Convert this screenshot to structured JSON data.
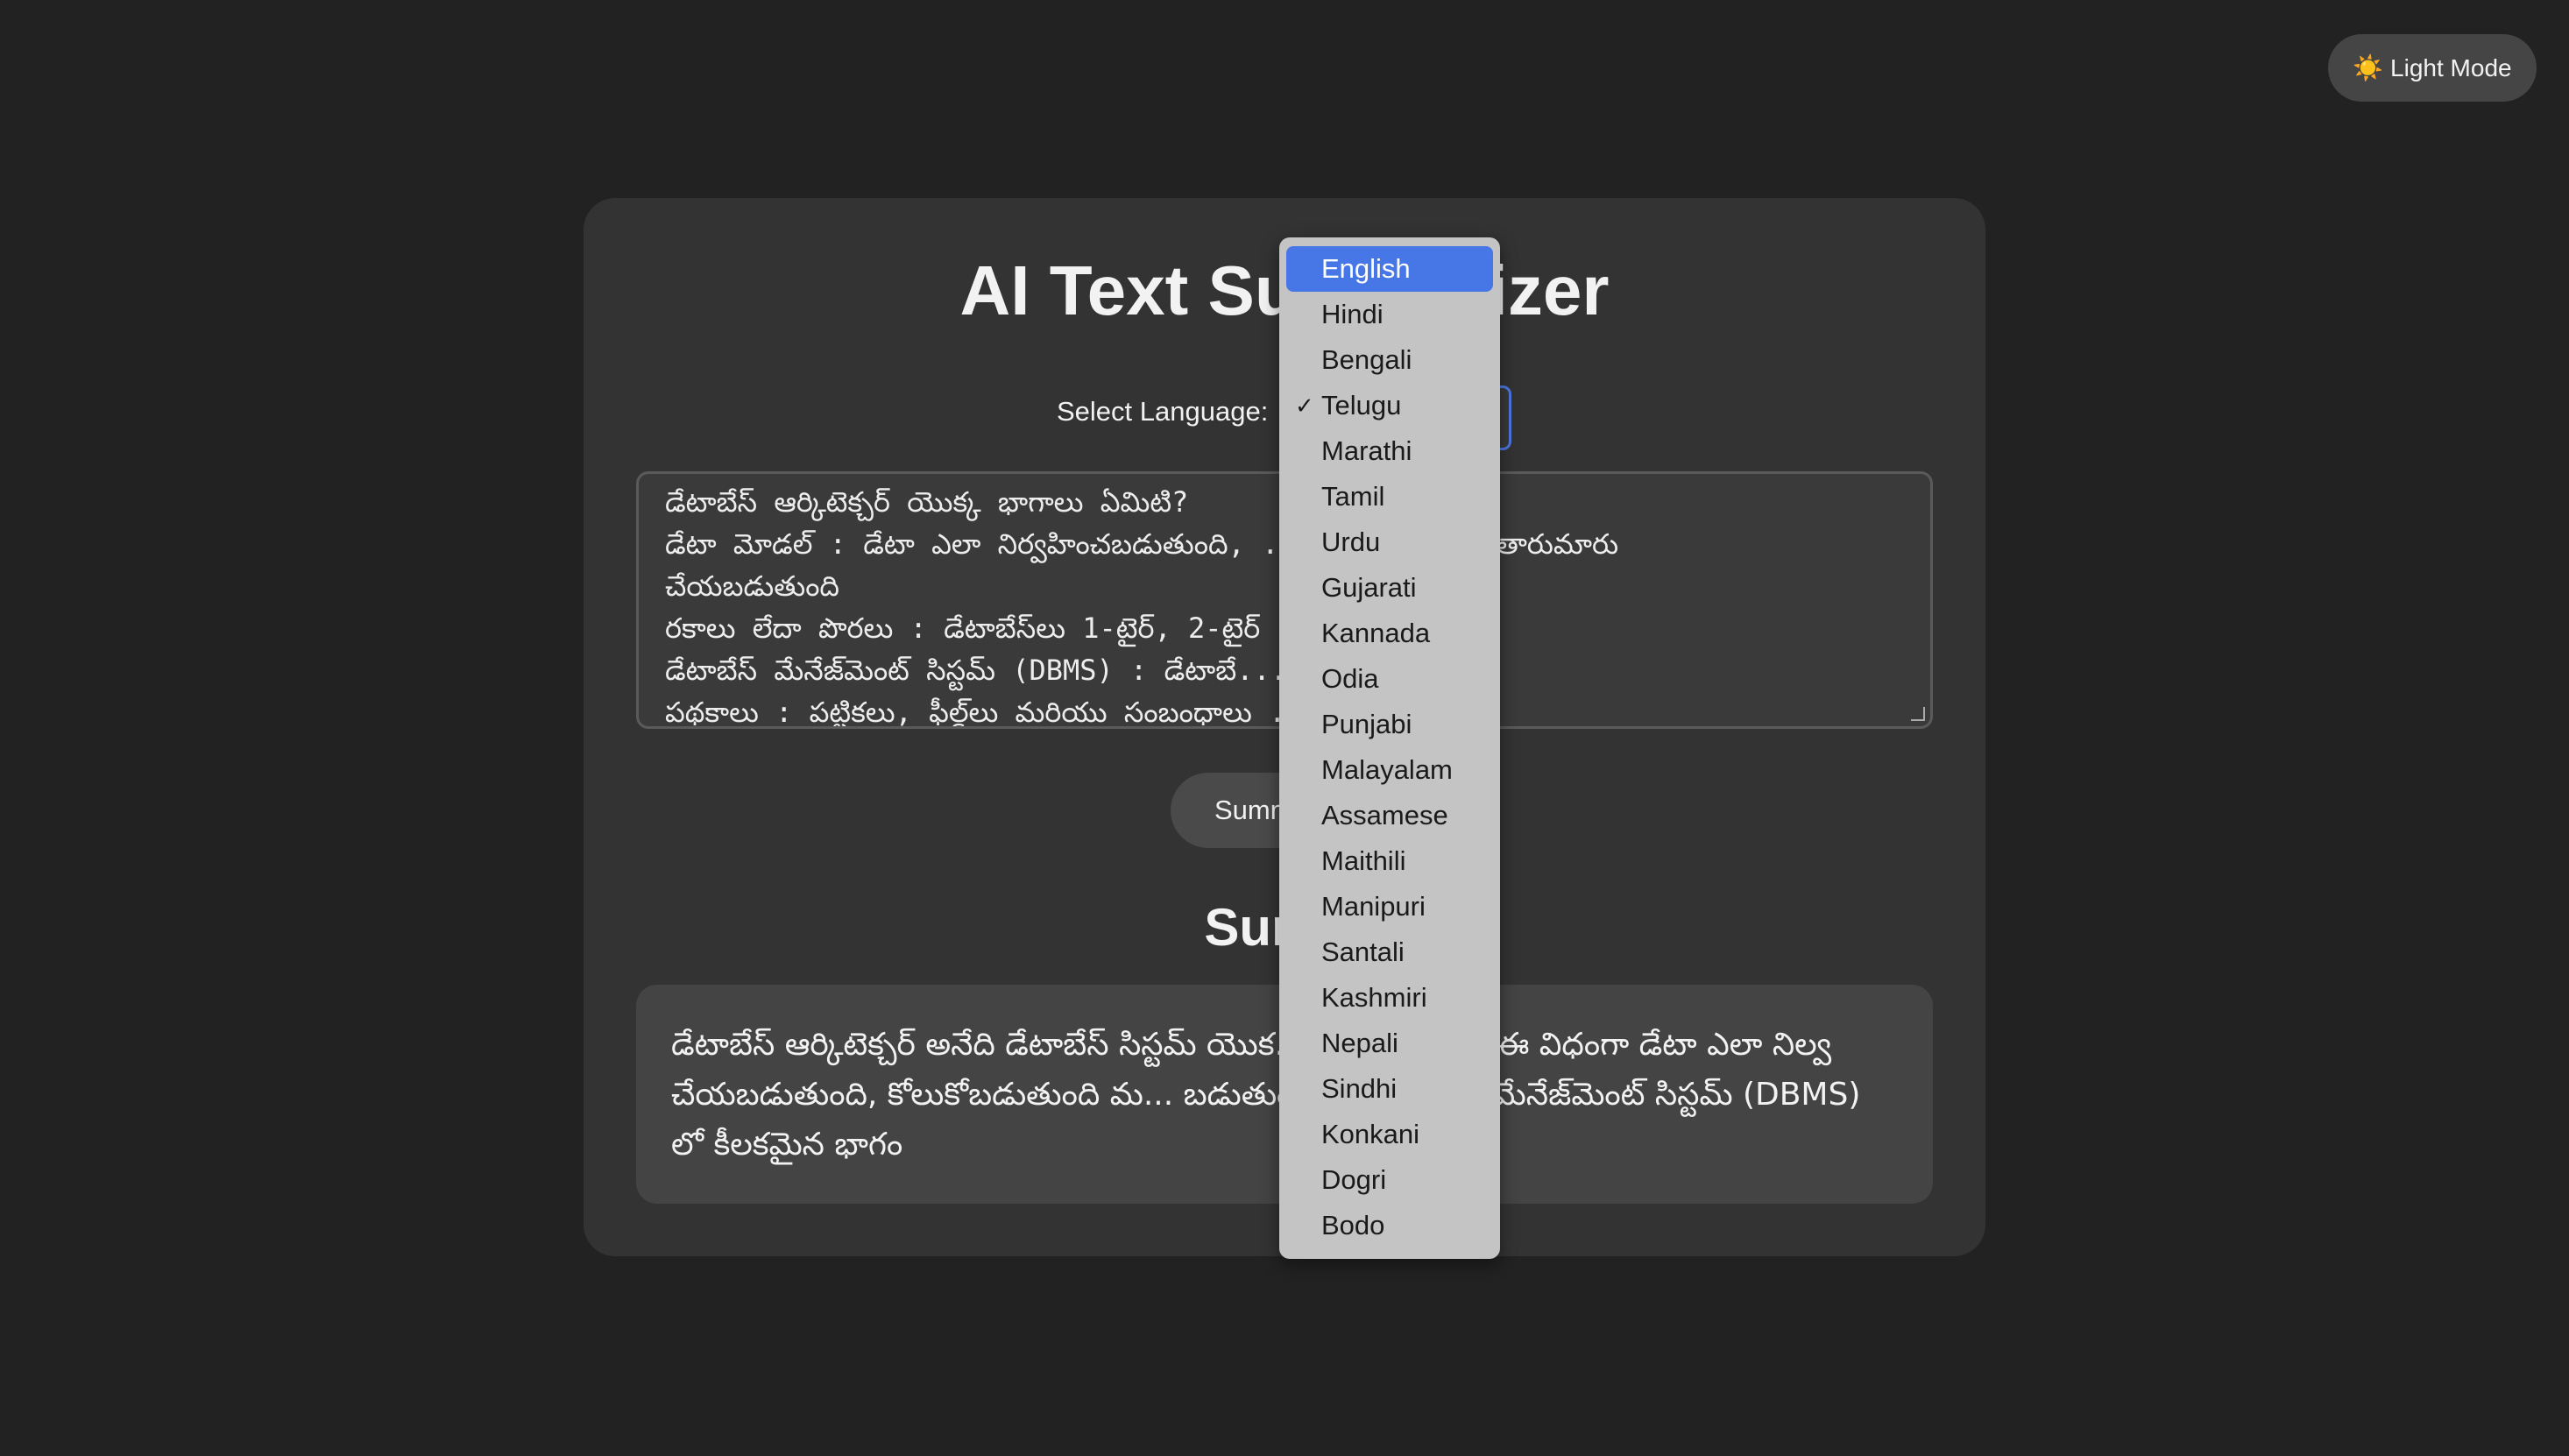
{
  "theme_toggle": {
    "icon": "sun-icon",
    "label": "☀️ Light Mode"
  },
  "app": {
    "title": "AI Text Summarizer"
  },
  "language": {
    "label": "Select Language:",
    "selected": "Telugu",
    "highlighted": "English",
    "options": [
      "English",
      "Hindi",
      "Bengali",
      "Telugu",
      "Marathi",
      "Tamil",
      "Urdu",
      "Gujarati",
      "Kannada",
      "Odia",
      "Punjabi",
      "Malayalam",
      "Assamese",
      "Maithili",
      "Manipuri",
      "Santali",
      "Kashmiri",
      "Nepali",
      "Sindhi",
      "Konkani",
      "Dogri",
      "Bodo"
    ]
  },
  "input": {
    "lines": [
      "డేటాబేస్ ఆర్కిటెక్చర్ యొక్క భాగాలు ఏమిటి?",
      "డేటా మోడల్ : డేటా ఎలా నిర్వహించబడుతుంది, ... ంది మరియు తారుమారు",
      "చేయబడుతుంది",
      "రకాలు లేదా పొరలు : డేటాబేస్‌లు 1-టైర్, 2-టైర్ ... చ్చు",
      "డేటాబేస్ మేనేజ్‌మెంట్ సిస్టమ్ (DBMS) : డేటాబే... ఫ్ట్‌వేర్",
      "పథకాలు : పట్టికలు, ఫీల్డ్‌లు మరియు సంబంధాలు ... యి"
    ]
  },
  "summarize_button": {
    "label": "Summ"
  },
  "summary": {
    "heading": "Summ",
    "text": "డేటాబేస్ ఆర్కిటెక్చర్ అనేది డేటాబేస్ సిస్టమ్ యొక... యు నిర్మాణం, ఈ విధంగా డేటా ఎలా నిల్వ చేయబడుతుంది, కోలుకోబడుతుంది మ... బడుతుంది.ఇది డేటాబేస్ మేనేజ్‌మెంట్ సిస్టమ్ (DBMS) లో కీలకమైన భాగం"
  },
  "colors": {
    "background": "#222222",
    "card": "#333333",
    "accent": "#4776e6",
    "dropdown_bg": "#c4c4c4"
  }
}
